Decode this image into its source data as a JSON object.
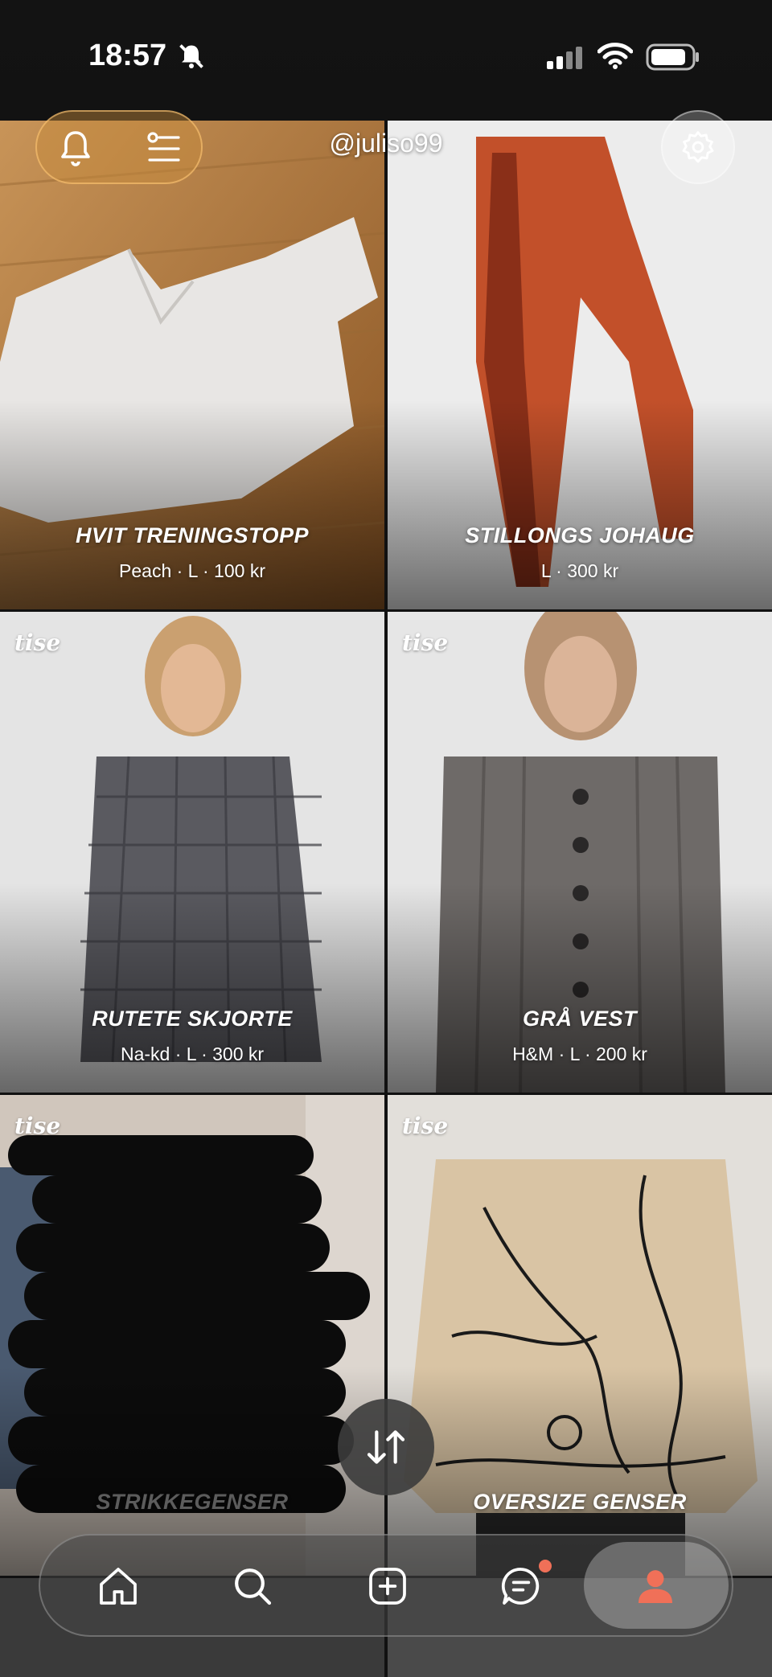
{
  "status_bar": {
    "time": "18:57"
  },
  "header": {
    "username": "@juliso99"
  },
  "brand_mark": "tise",
  "listings": [
    {
      "title": "HVIT TRENINGSTOPP",
      "meta": "Peach · L · 100 kr"
    },
    {
      "title": "STILLONGS JOHAUG",
      "meta": "L · 300 kr"
    },
    {
      "title": "RUTETE SKJORTE",
      "meta": "Na-kd · L · 300 kr"
    },
    {
      "title": "GRÅ VEST",
      "meta": "H&M · L · 200 kr"
    },
    {
      "title": "STRIKKEGENSER",
      "meta": ""
    },
    {
      "title": "OVERSIZE GENSER",
      "meta": ""
    }
  ],
  "tabbar": {
    "items": [
      "home",
      "search",
      "add",
      "messages",
      "profile"
    ],
    "active": "profile"
  },
  "colors": {
    "accent": "#f07058",
    "pill": "#c88c3c"
  }
}
